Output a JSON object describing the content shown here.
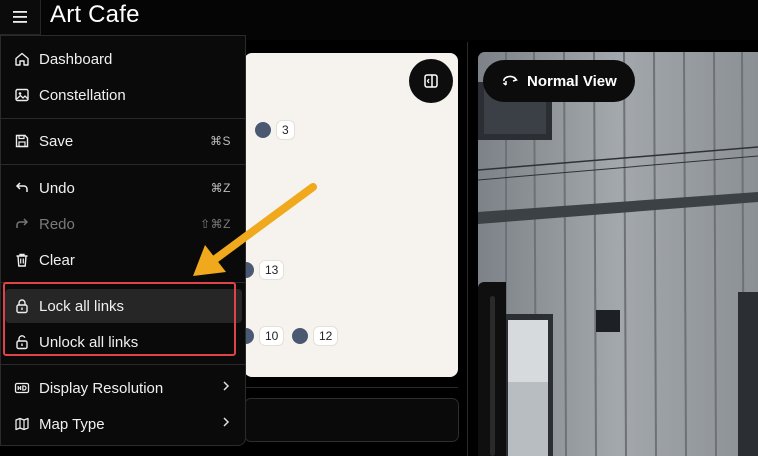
{
  "app": {
    "title": "Art Cafe"
  },
  "menu": {
    "items": [
      {
        "label": "Dashboard",
        "icon": "home-icon"
      },
      {
        "label": "Constellation",
        "icon": "image-icon"
      },
      {
        "label": "Save",
        "icon": "save-icon",
        "shortcut": "⌘S"
      },
      {
        "label": "Undo",
        "icon": "undo-icon",
        "shortcut": "⌘Z"
      },
      {
        "label": "Redo",
        "icon": "redo-icon",
        "shortcut": "⇧⌘Z",
        "disabled": true
      },
      {
        "label": "Clear",
        "icon": "trash-icon"
      },
      {
        "label": "Lock all links",
        "icon": "lock-icon"
      },
      {
        "label": "Unlock all links",
        "icon": "unlock-icon"
      },
      {
        "label": "Display Resolution",
        "icon": "hd-icon",
        "submenu": true
      },
      {
        "label": "Map Type",
        "icon": "map-icon",
        "submenu": true
      }
    ]
  },
  "canvas": {
    "nodes": [
      {
        "label": "3"
      },
      {
        "label": "13"
      },
      {
        "label": "10"
      },
      {
        "label": "12"
      }
    ]
  },
  "view": {
    "label": "Normal View"
  },
  "colors": {
    "highlight": "#e0424a",
    "arrow": "#f0a81c",
    "node": "#4a5872"
  }
}
